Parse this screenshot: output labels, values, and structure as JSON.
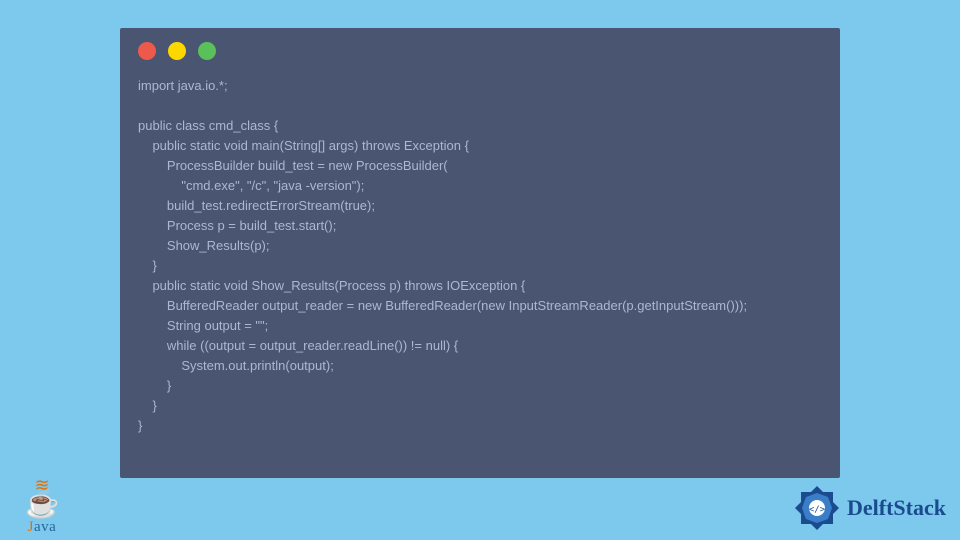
{
  "code_lines": [
    "import java.io.*;",
    "",
    "public class cmd_class {",
    "    public static void main(String[] args) throws Exception {",
    "        ProcessBuilder build_test = new ProcessBuilder(",
    "            \"cmd.exe\", \"/c\", \"java -version\");",
    "        build_test.redirectErrorStream(true);",
    "        Process p = build_test.start();",
    "        Show_Results(p);",
    "    }",
    "    public static void Show_Results(Process p) throws IOException {",
    "        BufferedReader output_reader = new BufferedReader(new InputStreamReader(p.getInputStream()));",
    "        String output = \"\";",
    "        while ((output = output_reader.readLine()) != null) {",
    "            System.out.println(output);",
    "        }",
    "    }",
    "}"
  ],
  "java_logo": {
    "text_j": "J",
    "text_rest": "ava"
  },
  "delft_logo": {
    "text": "DelftStack"
  },
  "colors": {
    "background": "#7cc9ed",
    "window_bg": "#4a5572",
    "code_text": "#aab8d4",
    "dot_red": "#ed594a",
    "dot_yellow": "#fdd800",
    "dot_green": "#5ac05a",
    "java_orange": "#e76f00",
    "java_blue": "#2a6496",
    "delft_blue": "#1a4b8f"
  }
}
